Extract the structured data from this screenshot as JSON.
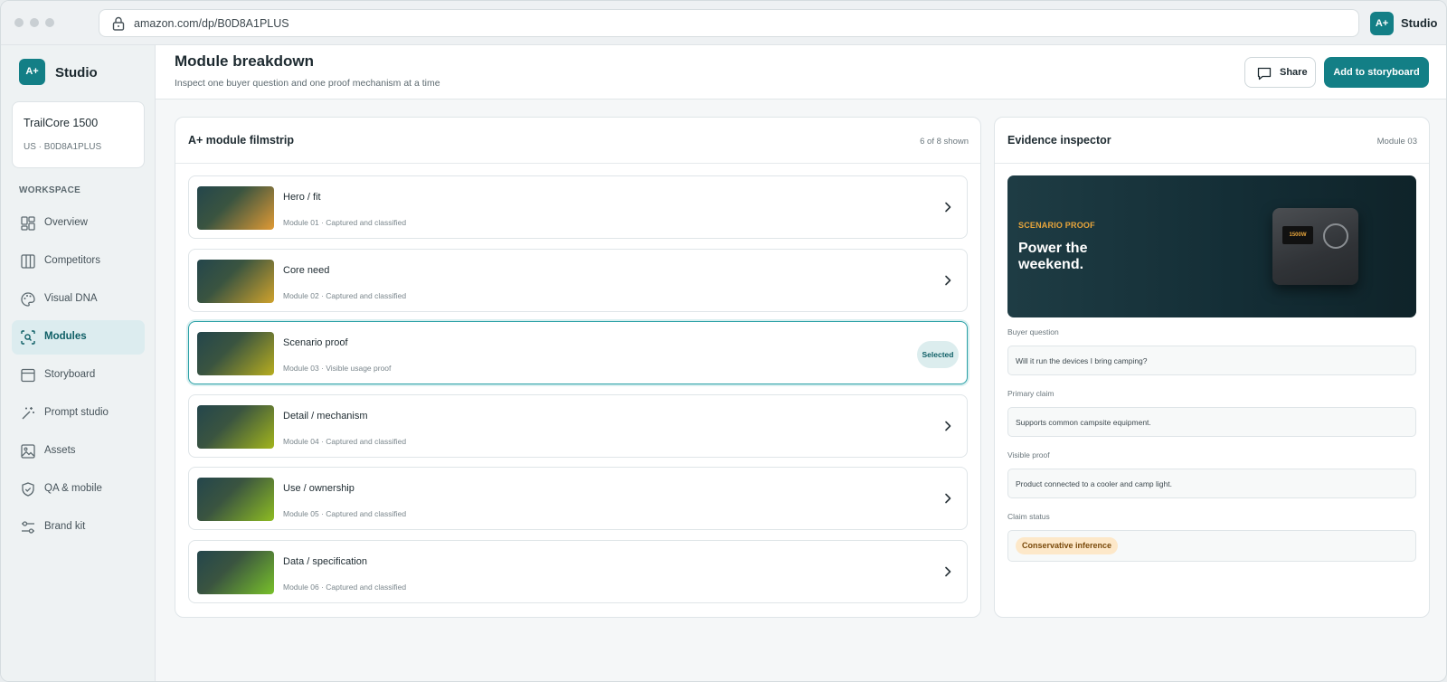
{
  "browser": {
    "url": "amazon.com/dp/B0D8A1PLUS",
    "ext_logo": "A+",
    "ext_name": "Studio"
  },
  "sidebar": {
    "logo": "A+",
    "app_name": "Studio",
    "product": {
      "name": "TrailCore 1500",
      "meta": "US · B0D8A1PLUS"
    },
    "section_label": "WORKSPACE",
    "items": [
      {
        "label": "Overview",
        "icon": "grid-icon"
      },
      {
        "label": "Competitors",
        "icon": "columns-icon"
      },
      {
        "label": "Visual DNA",
        "icon": "palette-icon"
      },
      {
        "label": "Modules",
        "icon": "module-search-icon",
        "active": true
      },
      {
        "label": "Storyboard",
        "icon": "storyboard-icon"
      },
      {
        "label": "Prompt studio",
        "icon": "magic-wand-icon"
      },
      {
        "label": "Assets",
        "icon": "image-icon"
      },
      {
        "label": "QA & mobile",
        "icon": "shield-check-icon"
      },
      {
        "label": "Brand kit",
        "icon": "sliders-icon"
      }
    ]
  },
  "header": {
    "title": "Module breakdown",
    "subtitle": "Inspect one buyer question and one proof mechanism at a time",
    "share_label": "Share",
    "add_label": "Add to storyboard"
  },
  "filmstrip": {
    "title": "A+ module filmstrip",
    "count": "6 of 8 shown",
    "selected_badge": "Selected",
    "modules": [
      {
        "name": "Hero / fit",
        "meta": "Module 01 · Captured and classified",
        "thumb_color": "#e09a35"
      },
      {
        "name": "Core need",
        "meta": "Module 02 · Captured and classified",
        "thumb_color": "#cfa22c"
      },
      {
        "name": "Scenario proof",
        "meta": "Module 03 · Visible usage proof",
        "thumb_color": "#b7ad1f",
        "selected": true
      },
      {
        "name": "Detail / mechanism",
        "meta": "Module 04 · Captured and classified",
        "thumb_color": "#a2b51c"
      },
      {
        "name": "Use / ownership",
        "meta": "Module 05 · Captured and classified",
        "thumb_color": "#8dbc22"
      },
      {
        "name": "Data / specification",
        "meta": "Module 06 · Captured and classified",
        "thumb_color": "#78c12a"
      }
    ]
  },
  "inspector": {
    "title": "Evidence inspector",
    "module_ref": "Module 03",
    "hero": {
      "kicker": "SCENARIO PROOF",
      "headline": "Power the weekend.",
      "device_label": "1500W"
    },
    "fields": [
      {
        "label": "Buyer question",
        "value": "Will it run the devices I bring camping?"
      },
      {
        "label": "Primary claim",
        "value": "Supports common campsite equipment."
      },
      {
        "label": "Visible proof",
        "value": "Product connected to a cooler and camp light."
      }
    ],
    "status_label": "Claim status",
    "status_value": "Conservative inference"
  },
  "colors": {
    "accent": "#137f86",
    "selected_border": "#2aa0a6",
    "status_bg": "#fde8c9",
    "kicker": "#e8a53b"
  }
}
